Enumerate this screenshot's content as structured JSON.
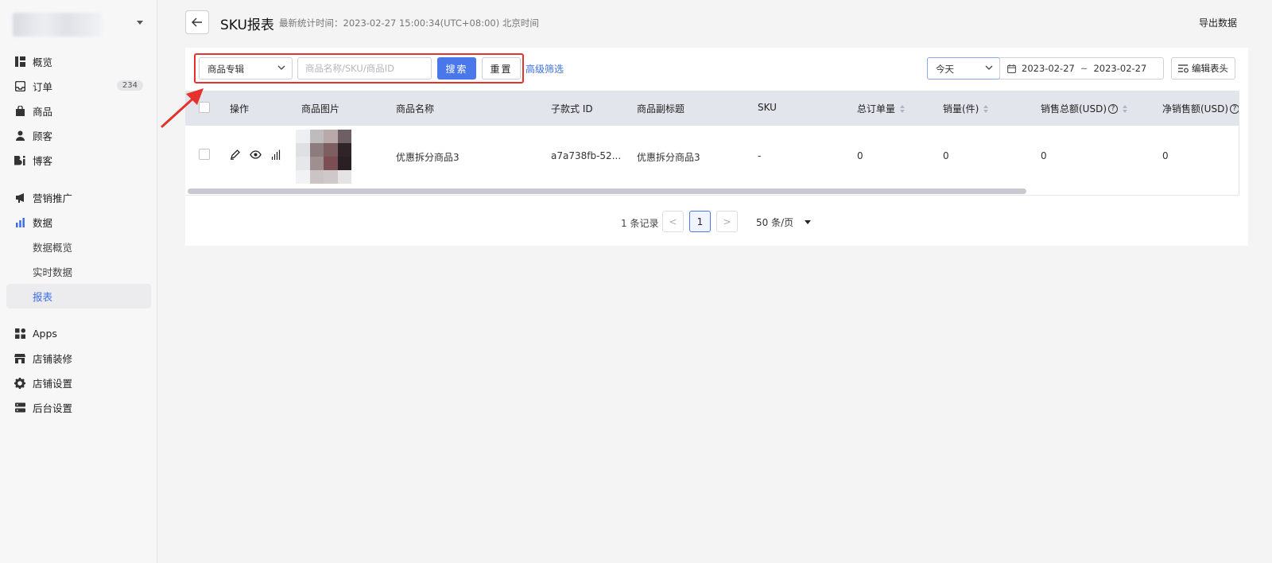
{
  "sidebar": {
    "items": [
      {
        "label": "概览",
        "icon": "overview-icon"
      },
      {
        "label": "订单",
        "icon": "inbox-icon",
        "badge": "234"
      },
      {
        "label": "商品",
        "icon": "bag-icon"
      },
      {
        "label": "顾客",
        "icon": "person-icon"
      },
      {
        "label": "博客",
        "icon": "blog-icon"
      },
      {
        "label": "营销推广",
        "icon": "megaphone-icon"
      },
      {
        "label": "数据",
        "icon": "bar-chart-icon"
      },
      {
        "label": "数据概览"
      },
      {
        "label": "实时数据"
      },
      {
        "label": "报表"
      },
      {
        "label": "Apps",
        "icon": "apps-icon"
      },
      {
        "label": "店铺装修",
        "icon": "store-icon"
      },
      {
        "label": "店铺设置",
        "icon": "gear-icon"
      },
      {
        "label": "后台设置",
        "icon": "server-icon"
      }
    ]
  },
  "header": {
    "title": "SKU报表",
    "update_time": "最新统计时间：2023-02-27 15:00:34(UTC+08:00) 北京时间",
    "export_label": "导出数据"
  },
  "toolbar": {
    "select_value": "商品专辑",
    "search_placeholder": "商品名称/SKU/商品ID",
    "search_label": "搜索",
    "reset_label": "重置",
    "advanced_label": "高级筛选",
    "period_value": "今天",
    "date_start": "2023-02-27",
    "date_sep": "~",
    "date_end": "2023-02-27",
    "edit_columns_label": "编辑表头"
  },
  "table": {
    "columns": [
      "操作",
      "商品图片",
      "商品名称",
      "子款式 ID",
      "商品副标题",
      "SKU",
      "总订单量",
      "销量(件)",
      "销售总额(USD)",
      "净销售额(USD)"
    ],
    "rows": [
      {
        "name": "优惠拆分商品3",
        "variant_id": "a7a738fb-52...",
        "subtitle": "优惠拆分商品3",
        "sku": "-",
        "total_orders": "0",
        "sales_qty": "0",
        "gross_sales": "0",
        "net_sales": "0"
      }
    ]
  },
  "pagination": {
    "total": "1 条记录",
    "prev": "<",
    "current_page": "1",
    "next": ">",
    "page_size": "50 条/页"
  },
  "colors": {
    "primary": "#4a78ea",
    "highlight_box": "#e5322d",
    "active_nav": "#3b6ee6"
  }
}
